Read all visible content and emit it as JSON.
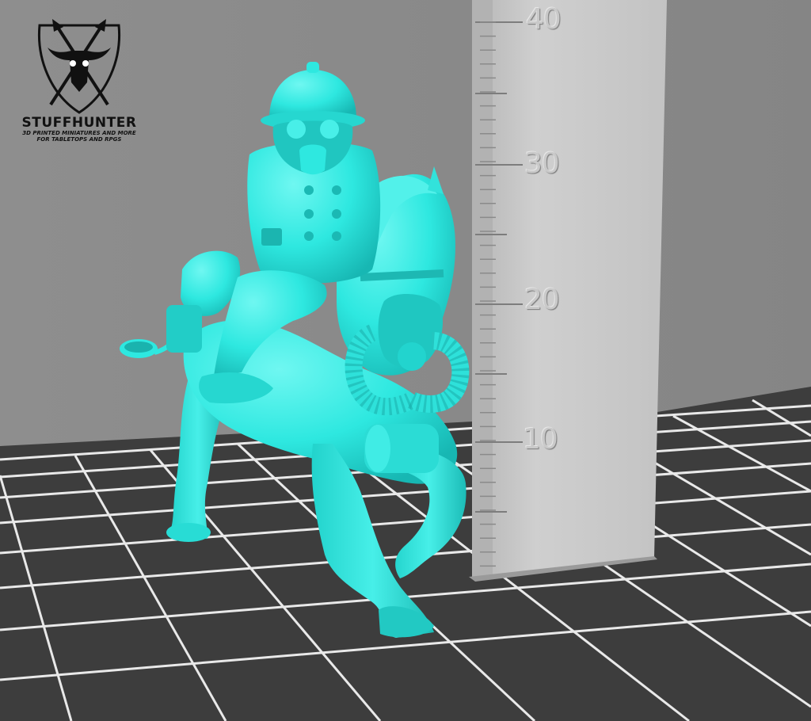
{
  "brand": {
    "name": "STUFFHUNTER",
    "tagline_line1": "3D PRINTED MINIATURES AND MORE",
    "tagline_line2": "FOR TABLETOPS AND RPGS"
  },
  "ruler": {
    "marks": [
      "40",
      "30",
      "20",
      "10"
    ]
  },
  "colors": {
    "model": "#2ee8e0",
    "model_shadow": "#15a9a6",
    "wall": "#8a8a8a",
    "floor": "#3c3c3c",
    "grid_lines": "#e8e8e8",
    "ruler": "#c4c4c4"
  }
}
